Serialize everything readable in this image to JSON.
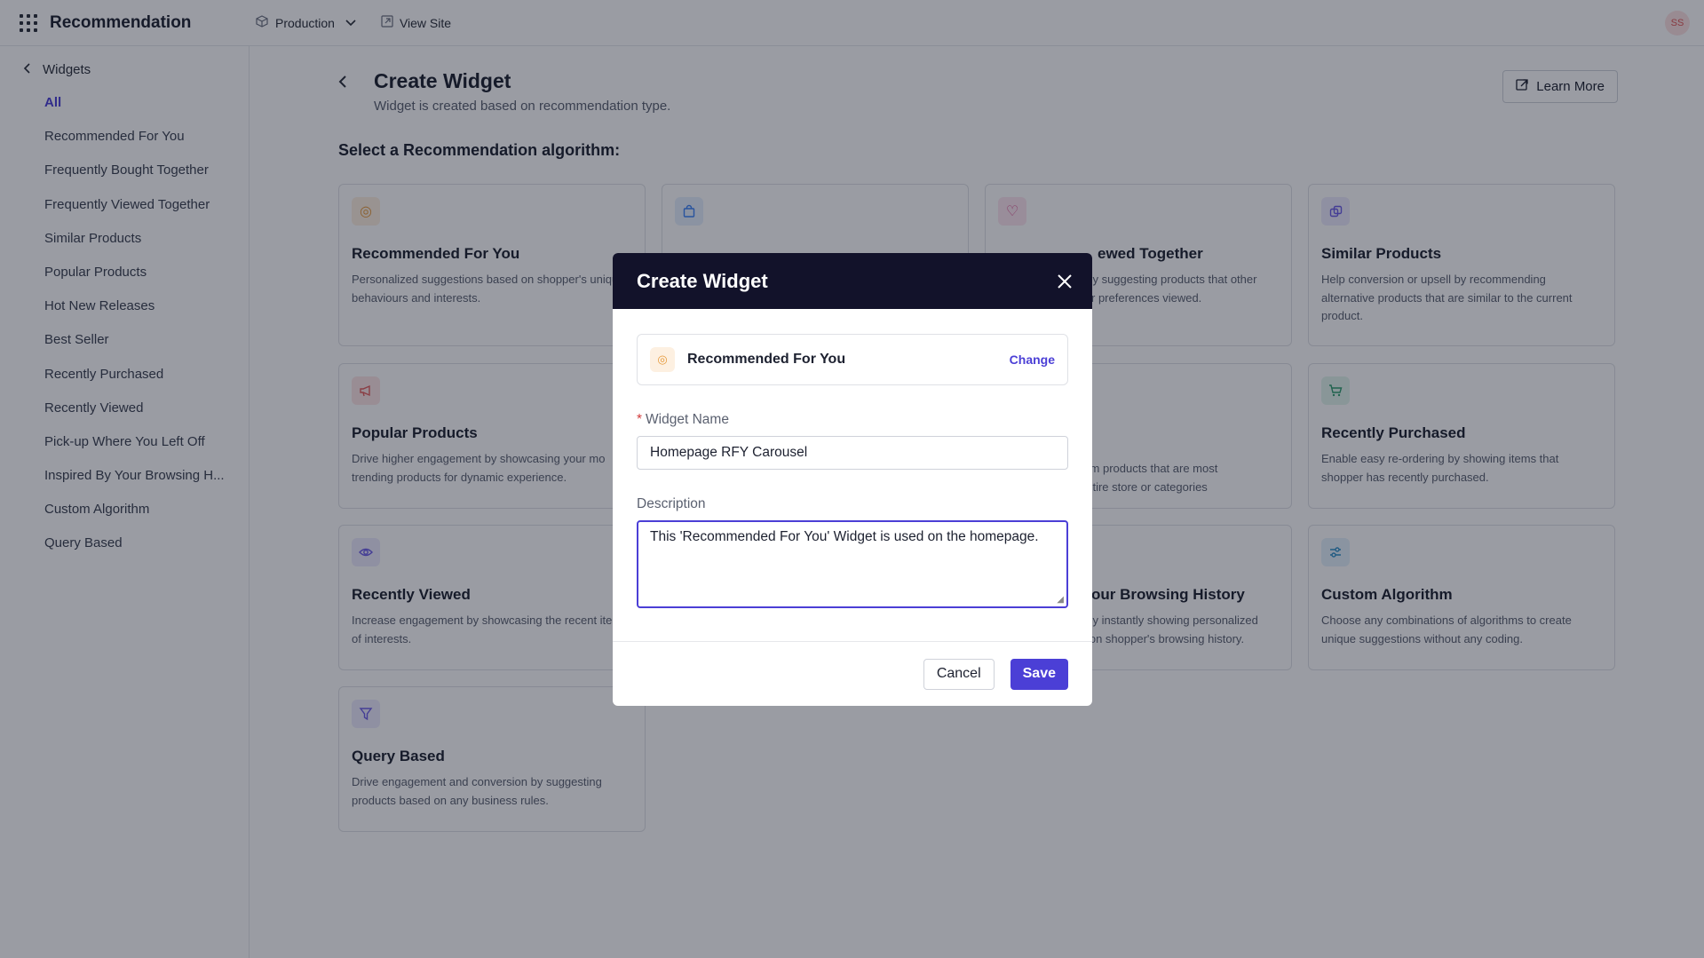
{
  "topbar": {
    "app_title": "Recommendation",
    "environment": "Production",
    "view_site": "View Site",
    "avatar_initials": "SS"
  },
  "sidebar": {
    "back_label": "Widgets",
    "items": [
      {
        "label": "All",
        "active": true
      },
      {
        "label": "Recommended For You"
      },
      {
        "label": "Frequently Bought Together"
      },
      {
        "label": "Frequently Viewed Together"
      },
      {
        "label": "Similar Products"
      },
      {
        "label": "Popular Products"
      },
      {
        "label": "Hot New Releases"
      },
      {
        "label": "Best Seller"
      },
      {
        "label": "Recently Purchased"
      },
      {
        "label": "Recently Viewed"
      },
      {
        "label": "Pick-up Where You Left Off"
      },
      {
        "label": "Inspired By Your Browsing H..."
      },
      {
        "label": "Custom Algorithm"
      },
      {
        "label": "Query Based"
      }
    ]
  },
  "page": {
    "title": "Create Widget",
    "subtitle": "Widget is created based on recommendation type.",
    "learn_more": "Learn More",
    "select_label": "Select a Recommendation algorithm:"
  },
  "cards": [
    {
      "title": "Recommended For You",
      "desc": "Personalized suggestions based on shopper's unique behaviours and interests.",
      "icon": "target-icon",
      "color": "#e69a3c",
      "bg": "#fdf0e1"
    },
    {
      "title": "",
      "desc": "",
      "icon": "shopping-bag-icon",
      "color": "#3b82f6",
      "bg": "#e6f0fe"
    },
    {
      "title": "ewed Together",
      "desc": "t by suggesting products that other\nilar preferences viewed.",
      "icon": "heart-icon",
      "color": "#d9468a",
      "bg": "#fde6f0"
    },
    {
      "title": "Similar Products",
      "desc": "Help conversion or upsell by recommending alternative products that are similar to the current product.",
      "icon": "copy-icon",
      "color": "#6c5ce7",
      "bg": "#ecebfd"
    },
    {
      "title": "Popular Products",
      "desc": "Drive higher engagement by showcasing your mo trending products for dynamic experience.",
      "icon": "megaphone-icon",
      "color": "#e35d5d",
      "bg": "#fde6e6"
    },
    {
      "title": "",
      "desc": "rom products that are most\nentire store or categories",
      "icon": "",
      "color": "#ffffff",
      "bg": "#ffffff"
    },
    {
      "title": "Recently Purchased",
      "desc": "Enable easy re-ordering by showing items that shopper has recently purchased.",
      "icon": "cart-icon",
      "color": "#2f9e6e",
      "bg": "#e2f5ec"
    },
    {
      "title": "Recently Viewed",
      "desc": "Increase engagement by showcasing the recent items of interests.",
      "icon": "eye-icon",
      "color": "#6c5ce7",
      "bg": "#ecebfd"
    },
    {
      "title": "our Browsing History",
      "desc": "t by instantly showing personalized\nd on shopper's browsing history.",
      "icon": "",
      "color": "#ffffff",
      "bg": "#ffffff"
    },
    {
      "title": "Custom Algorithm",
      "desc": "Choose any combinations of algorithms to create unique suggestions without any coding.",
      "icon": "sliders-icon",
      "color": "#2e8fc9",
      "bg": "#e3f2fb"
    },
    {
      "title": "Query Based",
      "desc": "Drive engagement and conversion by suggesting products based on any business rules.",
      "icon": "filter-icon",
      "color": "#6c5ce7",
      "bg": "#ecebfd"
    }
  ],
  "modal": {
    "title": "Create Widget",
    "selected_algorithm": "Recommended For You",
    "change": "Change",
    "widget_name_label": "Widget Name",
    "widget_name_value": "Homepage RFY Carousel",
    "description_label": "Description",
    "description_value": "This 'Recommended For You' Widget is used on the homepage.",
    "cancel": "Cancel",
    "save": "Save"
  }
}
